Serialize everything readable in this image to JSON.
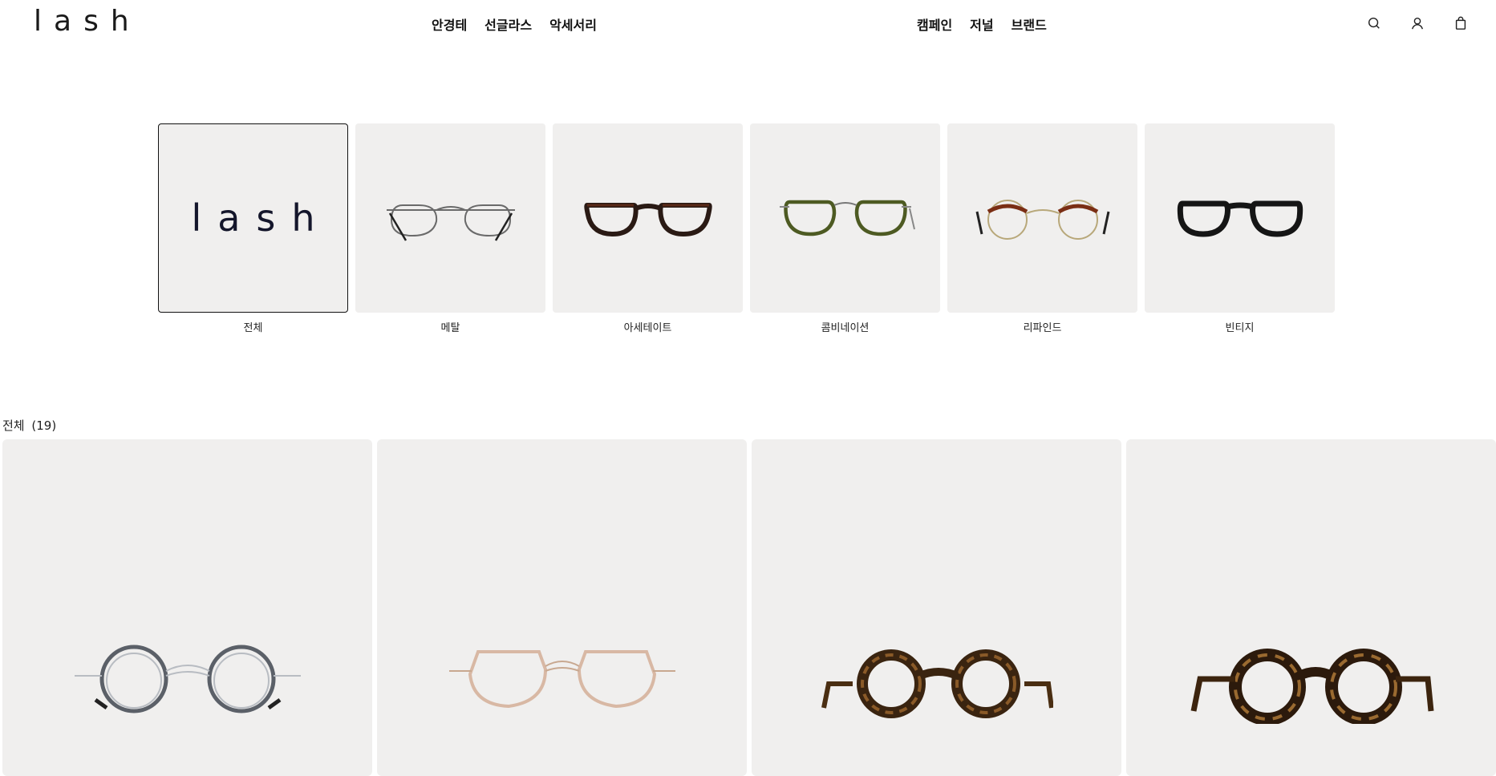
{
  "header": {
    "logo": "lash",
    "nav_left": [
      {
        "label": "안경테"
      },
      {
        "label": "선글라스"
      },
      {
        "label": "악세서리"
      }
    ],
    "nav_right": [
      {
        "label": "캠페인"
      },
      {
        "label": "저널"
      },
      {
        "label": "브랜드"
      }
    ],
    "icons": [
      "search-icon",
      "user-icon",
      "bag-icon"
    ]
  },
  "categories": [
    {
      "label": "전체",
      "logo_text": "lash",
      "active": true
    },
    {
      "label": "메탈"
    },
    {
      "label": "아세테이트"
    },
    {
      "label": "콤비네이션"
    },
    {
      "label": "리파인드"
    },
    {
      "label": "빈티지"
    }
  ],
  "listing": {
    "title": "전체",
    "count": "(19)"
  },
  "colors": {
    "thumb_bg": "#f0efee",
    "text": "#111111"
  }
}
